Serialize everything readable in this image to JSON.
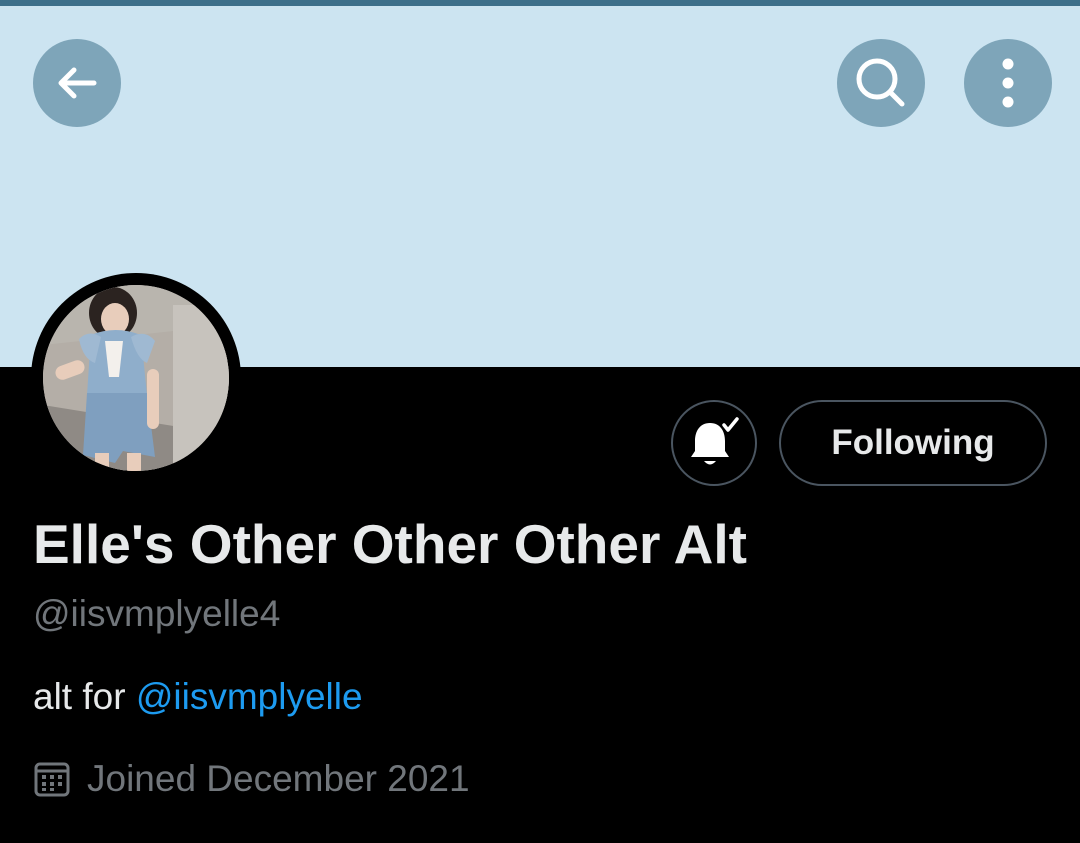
{
  "header": {
    "back_icon": "arrow-left-icon",
    "search_icon": "search-icon",
    "more_icon": "more-vertical-icon"
  },
  "colors": {
    "banner": "#cce4f1",
    "header_button": "#7ea5b9",
    "link": "#1d9bf0",
    "secondary_text": "#71767b",
    "primary_text": "#e7e9ea"
  },
  "profile": {
    "display_name": "Elle's Other Other Other Alt",
    "handle": "@iisvmplyelle4",
    "bio_prefix": "alt for ",
    "bio_mention": "@iisvmplyelle",
    "joined": "Joined December 2021",
    "joined_icon": "calendar-icon"
  },
  "actions": {
    "notifications_icon": "bell-subscribed-icon",
    "follow_label": "Following"
  }
}
